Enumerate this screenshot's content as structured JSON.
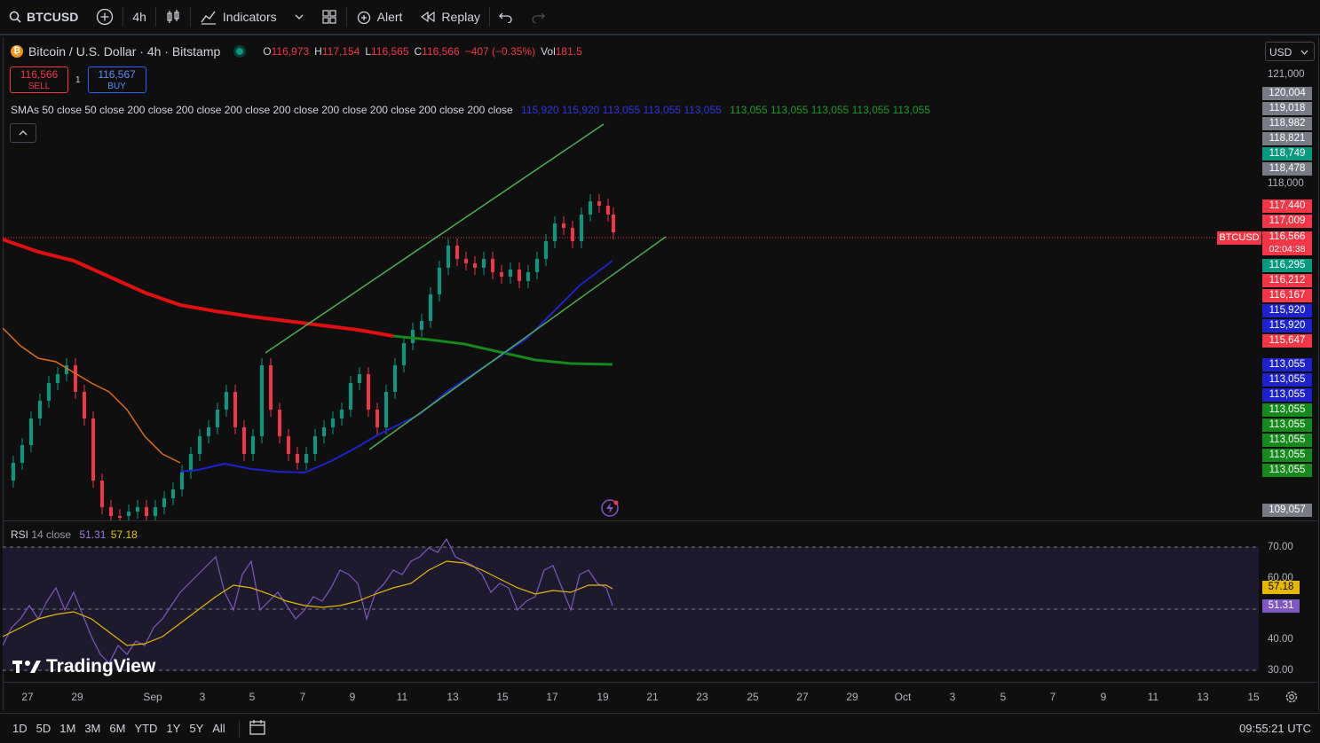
{
  "toolbar": {
    "symbol": "BTCUSD",
    "interval": "4h",
    "indicators": "Indicators",
    "alert": "Alert",
    "replay": "Replay"
  },
  "legend": {
    "title": "Bitcoin / U.S. Dollar · 4h · Bitstamp",
    "o_label": "O",
    "o": "116,973",
    "h_label": "H",
    "h": "117,154",
    "l_label": "L",
    "l": "116,565",
    "c_label": "C",
    "c": "116,566",
    "change": "−407 (−0.35%)",
    "vol_label": "Vol",
    "vol": "181.5"
  },
  "trade": {
    "sell_price": "116,566",
    "sell_label": "SELL",
    "spread": "1",
    "buy_price": "116,567",
    "buy_label": "BUY"
  },
  "sma_legend": {
    "text": "SMAs 50 close 50 close 200 close 200 close 200 close 200 close 200 close 200 close 200 close 200 close",
    "values_blue": "115,920 115,920 113,055 113,055 113,055",
    "values_green": "113,055 113,055 113,055 113,055 113,055"
  },
  "price_scale": {
    "currency": "USD",
    "labels": [
      "121,000",
      "118,000"
    ],
    "boxes": [
      {
        "text": "120,004",
        "color": "#787b86"
      },
      {
        "text": "119,018",
        "color": "#787b86"
      },
      {
        "text": "118,982",
        "color": "#787b86"
      },
      {
        "text": "118,821",
        "color": "#787b86"
      },
      {
        "text": "118,749",
        "color": "#089981"
      },
      {
        "text": "118,478",
        "color": "#787b86"
      },
      {
        "text": "117,440",
        "color": "#f23645"
      },
      {
        "text": "117,009",
        "color": "#f23645"
      },
      {
        "text": "116,566",
        "color": "#f23645"
      },
      {
        "text": "116,295",
        "color": "#089981"
      },
      {
        "text": "116,212",
        "color": "#f23645"
      },
      {
        "text": "116,167",
        "color": "#f23645"
      },
      {
        "text": "115,920",
        "color": "#1e22cc"
      },
      {
        "text": "115,920",
        "color": "#1e22cc"
      },
      {
        "text": "115,647",
        "color": "#f23645"
      },
      {
        "text": "113,055",
        "color": "#1e22cc"
      },
      {
        "text": "113,055",
        "color": "#1e22cc"
      },
      {
        "text": "113,055",
        "color": "#1e22cc"
      },
      {
        "text": "113,055",
        "color": "#138a1a"
      },
      {
        "text": "113,055",
        "color": "#138a1a"
      },
      {
        "text": "113,055",
        "color": "#138a1a"
      },
      {
        "text": "113,055",
        "color": "#138a1a"
      },
      {
        "text": "113,055",
        "color": "#138a1a"
      },
      {
        "text": "109,057",
        "color": "#787b86"
      }
    ],
    "last_tag": "BTCUSD",
    "countdown": "02:04:38"
  },
  "rsi": {
    "label": "RSI",
    "params": "14 close",
    "value": "51.31",
    "ma_value": "57.18",
    "levels": [
      "70.00",
      "60.00",
      "40.00",
      "30.00"
    ]
  },
  "x_axis": [
    "27",
    "29",
    "Sep",
    "3",
    "5",
    "7",
    "9",
    "11",
    "13",
    "15",
    "17",
    "19",
    "21",
    "23",
    "25",
    "27",
    "29",
    "Oct",
    "3",
    "5",
    "7",
    "9",
    "11",
    "13",
    "15"
  ],
  "ranges": [
    "1D",
    "5D",
    "1M",
    "3M",
    "6M",
    "YTD",
    "1Y",
    "5Y",
    "All"
  ],
  "clock": "09:55:21 UTC",
  "logo": "TradingView",
  "colors": {
    "up": "#089981",
    "down": "#f23645",
    "sma50": "#1e22cc",
    "sma200_red": "#e01010",
    "sma200_green": "#138a1a",
    "orange": "#e06b12",
    "channel": "#4caf50",
    "rsi": "#7e57c2",
    "rsi_ma": "#e6b800"
  }
}
